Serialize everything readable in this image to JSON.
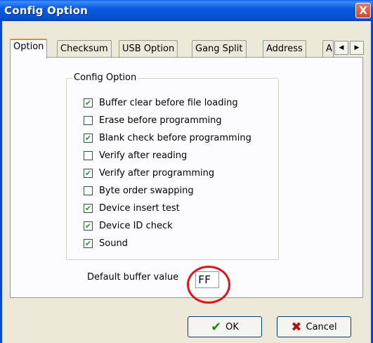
{
  "window": {
    "title": "Config Option",
    "close_label": "X"
  },
  "tabs": [
    {
      "label": "Option"
    },
    {
      "label": "Checksum"
    },
    {
      "label": "USB Option"
    },
    {
      "label": "Gang Split"
    },
    {
      "label": "Address"
    },
    {
      "label": "A"
    }
  ],
  "tab_scroll": {
    "left": "◀",
    "right": "▶"
  },
  "group": {
    "title": "Config Option",
    "options": [
      {
        "label": "Buffer clear before file loading",
        "checked": true
      },
      {
        "label": "Erase before programming",
        "checked": false
      },
      {
        "label": "Blank check before programming",
        "checked": true
      },
      {
        "label": "Verify after reading",
        "checked": false
      },
      {
        "label": "Verify after programming",
        "checked": true
      },
      {
        "label": "Byte order swapping",
        "checked": false
      },
      {
        "label": "Device insert test",
        "checked": true
      },
      {
        "label": "Device ID check",
        "checked": true
      },
      {
        "label": "Sound",
        "checked": true
      }
    ]
  },
  "buffer": {
    "label": "Default buffer value",
    "value": "FF"
  },
  "buttons": {
    "ok": "OK",
    "cancel": "Cancel",
    "ok_icon": "check-icon",
    "cancel_icon": "x-icon"
  },
  "colors": {
    "title_bar": "#0a5ae0",
    "highlight_circle": "#e0141b",
    "ok_check": "#1d8a18",
    "cancel_x": "#b01010"
  }
}
